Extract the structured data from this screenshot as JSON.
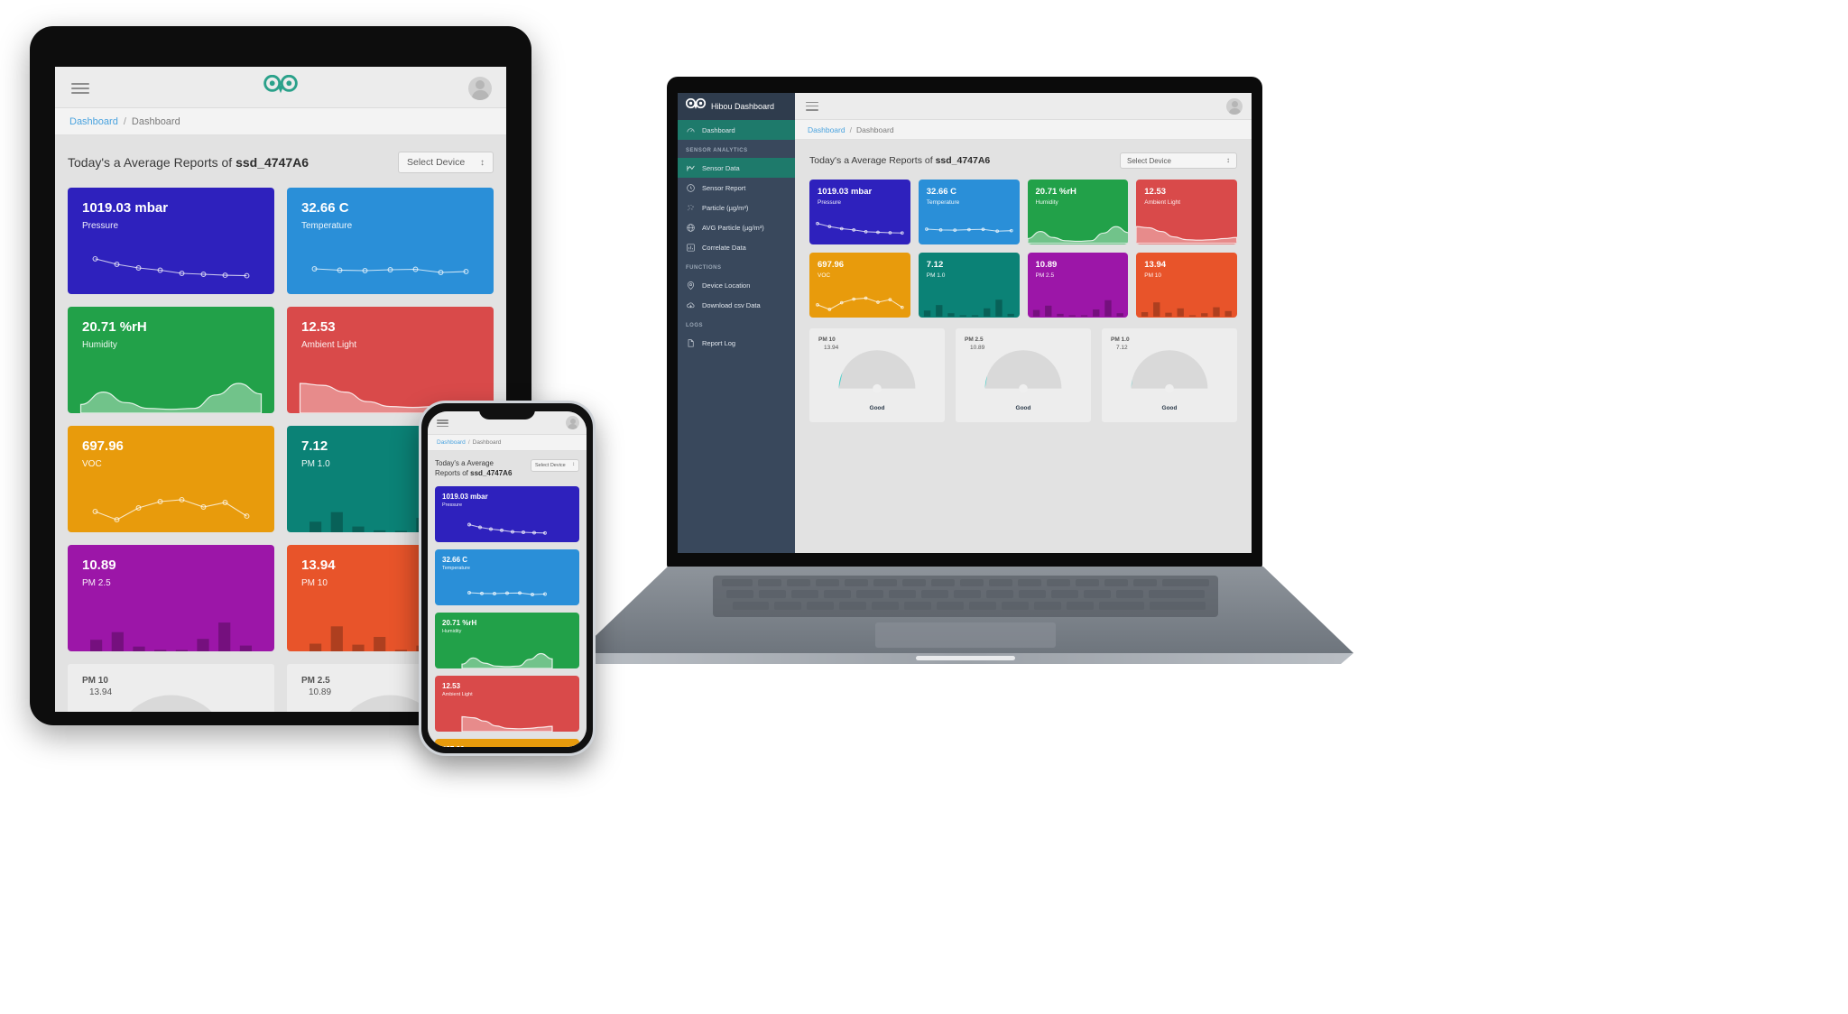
{
  "app": {
    "brand_name": "Hibou Dashboard",
    "logo_icon": "owl-logo-icon",
    "accent_color": "#2aa18a",
    "sidebar_bg": "#39485c"
  },
  "header": {
    "menu_icon": "hamburger-menu-icon",
    "avatar_icon": "user-avatar-icon"
  },
  "breadcrumb": {
    "root": "Dashboard",
    "separator": "/",
    "current": "Dashboard"
  },
  "main": {
    "title_prefix": "Today's a Average Reports of ",
    "device_id": "ssd_4747A6",
    "select_device_label": "Select Device"
  },
  "sidebar": {
    "items": [
      {
        "label": "Dashboard",
        "icon": "speedometer-icon",
        "active": true,
        "section": null
      },
      {
        "label": "SENSOR ANALYTICS",
        "icon": null,
        "active": false,
        "section": true
      },
      {
        "label": "Sensor Data",
        "icon": "line-chart-icon",
        "active": true,
        "section": null
      },
      {
        "label": "Sensor Report",
        "icon": "clock-icon",
        "active": false,
        "section": null
      },
      {
        "label": "Particle (µg/m³)",
        "icon": "particles-icon",
        "active": false,
        "section": null
      },
      {
        "label": "AVG Particle (µg/m³)",
        "icon": "globe-icon",
        "active": false,
        "section": null
      },
      {
        "label": "Correlate Data",
        "icon": "bar-chart-icon",
        "active": false,
        "section": null
      },
      {
        "label": "FUNCTIONS",
        "icon": null,
        "active": false,
        "section": true
      },
      {
        "label": "Device Location",
        "icon": "map-pin-icon",
        "active": false,
        "section": null
      },
      {
        "label": "Download csv Data",
        "icon": "cloud-download-icon",
        "active": false,
        "section": null
      },
      {
        "label": "LOGS",
        "icon": null,
        "active": false,
        "section": true
      },
      {
        "label": "Report Log",
        "icon": "document-icon",
        "active": false,
        "section": null
      }
    ]
  },
  "chart_data": {
    "type": "bar",
    "title": "Today's a Average Reports of ssd_4747A6",
    "cards": [
      {
        "value": "1019.03 mbar",
        "label": "Pressure",
        "color": "#2e21bd",
        "icon": "gauge-icon",
        "spark": "line",
        "points": [
          72,
          60,
          52,
          47,
          40,
          38,
          36,
          35
        ]
      },
      {
        "value": "32.66 C",
        "label": "Temperature",
        "color": "#2a8fd8",
        "icon": "thermometer-icon",
        "spark": "line",
        "points": [
          50,
          47,
          46,
          48,
          49,
          42,
          44
        ]
      },
      {
        "value": "20.71 %rH",
        "label": "Humidity",
        "color": "#22a149",
        "icon": "water-drop-icon",
        "spark": "area",
        "points": [
          18,
          44,
          22,
          10,
          8,
          10,
          38,
          62,
          40
        ]
      },
      {
        "value": "12.53",
        "label": "Ambient Light",
        "color": "#d94a4a",
        "icon": "sun-icon",
        "spark": "area",
        "points": [
          62,
          58,
          44,
          24,
          14,
          12,
          14,
          18,
          22
        ]
      },
      {
        "value": "697.96",
        "label": "VOC",
        "color": "#e89b0c",
        "icon": "sun-burst-icon",
        "spark": "line",
        "points": [
          40,
          22,
          48,
          62,
          66,
          50,
          60,
          30
        ]
      },
      {
        "value": "7.12",
        "label": "PM 1.0",
        "color": "#0b8276",
        "icon": "sun-burst-icon",
        "spark": "bars",
        "points": [
          22,
          42,
          12,
          4,
          2,
          30,
          62,
          10
        ]
      },
      {
        "value": "10.89",
        "label": "PM 2.5",
        "color": "#9c16a8",
        "icon": "double-particle-icon",
        "spark": "bars",
        "points": [
          24,
          40,
          10,
          3,
          2,
          26,
          60,
          12
        ]
      },
      {
        "value": "13.94",
        "label": "PM 10",
        "color": "#e8542a",
        "icon": "double-particle-icon",
        "spark": "bars",
        "points": [
          16,
          52,
          14,
          30,
          3,
          12,
          34,
          20
        ]
      }
    ],
    "gauges": [
      {
        "label": "PM 10",
        "value": "13.94",
        "status": "Good",
        "pct": 14,
        "color": "#3fd0c9"
      },
      {
        "label": "PM 2.5",
        "value": "10.89",
        "status": "Good",
        "pct": 11,
        "color": "#3fd0c9"
      },
      {
        "label": "PM 1.0",
        "value": "7.12",
        "status": "Good",
        "pct": 8,
        "color": "#3fd0c9"
      }
    ],
    "xlabel": "",
    "ylabel": "",
    "legend": []
  }
}
